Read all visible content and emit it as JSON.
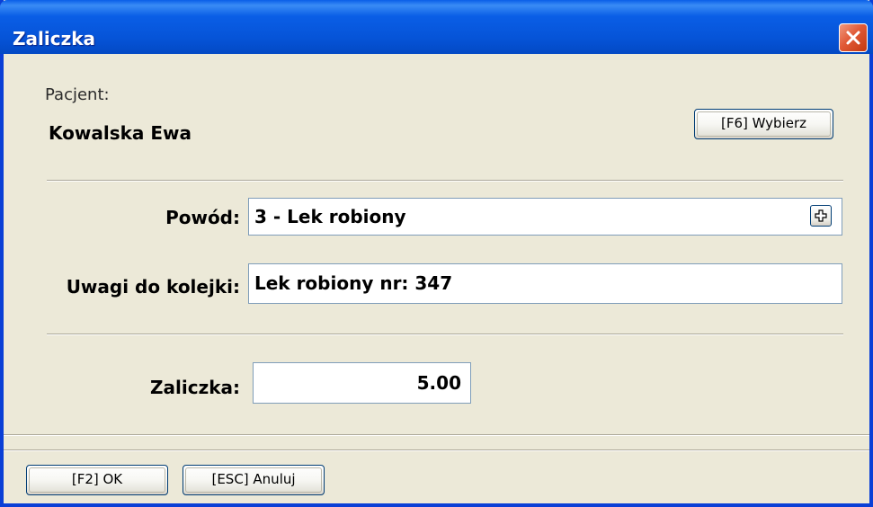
{
  "window": {
    "title": "Zaliczka"
  },
  "patient": {
    "caption": "Pacjent:",
    "name": "Kowalska Ewa",
    "select_button_label": "[F6] Wybierz"
  },
  "form": {
    "reason_label": "Powód:",
    "reason_value": "3 - Lek robiony",
    "queue_notes_label": "Uwagi do kolejki:",
    "queue_notes_value": "Lek robiony nr: 347",
    "advance_label": "Zaliczka:",
    "advance_value": "5.00"
  },
  "footer": {
    "ok_label": "[F2] OK",
    "cancel_label": "[ESC] Anuluj"
  },
  "colors": {
    "titlebar": "#0654d8",
    "window_bg": "#ece9d8",
    "close_button": "#e15a37",
    "field_border": "#7f9db9"
  }
}
